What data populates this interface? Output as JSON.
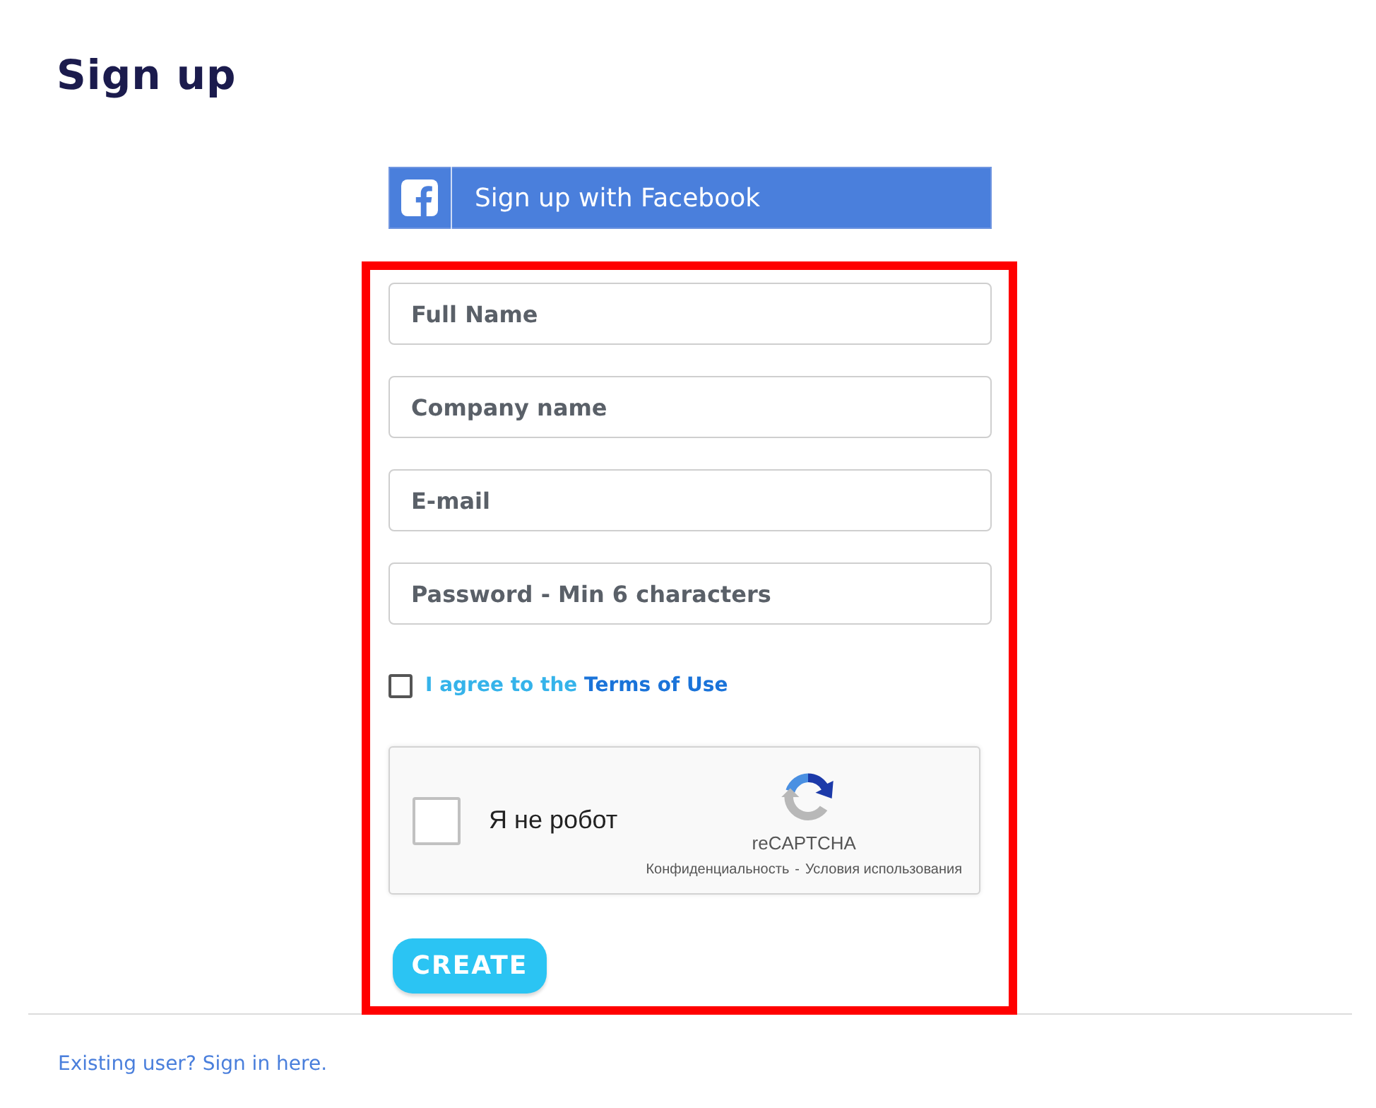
{
  "title": "Sign up",
  "facebook_button": {
    "label": "Sign up with Facebook"
  },
  "fields": [
    {
      "placeholder": "Full Name"
    },
    {
      "placeholder": "Company name"
    },
    {
      "placeholder": "E-mail"
    },
    {
      "placeholder": "Password - Min 6 characters"
    }
  ],
  "terms": {
    "checked": false,
    "text": "I agree to the",
    "link": "Terms of Use"
  },
  "captcha": {
    "checked": false,
    "label": "Я не робот",
    "brand": "reCAPTCHA",
    "privacy": "Конфиденциальность",
    "separator": "-",
    "terms": "Условия использования"
  },
  "create_button": {
    "label": "CREATE"
  },
  "highlight": {
    "shown": true
  },
  "footer_link": "Existing user? Sign in here."
}
